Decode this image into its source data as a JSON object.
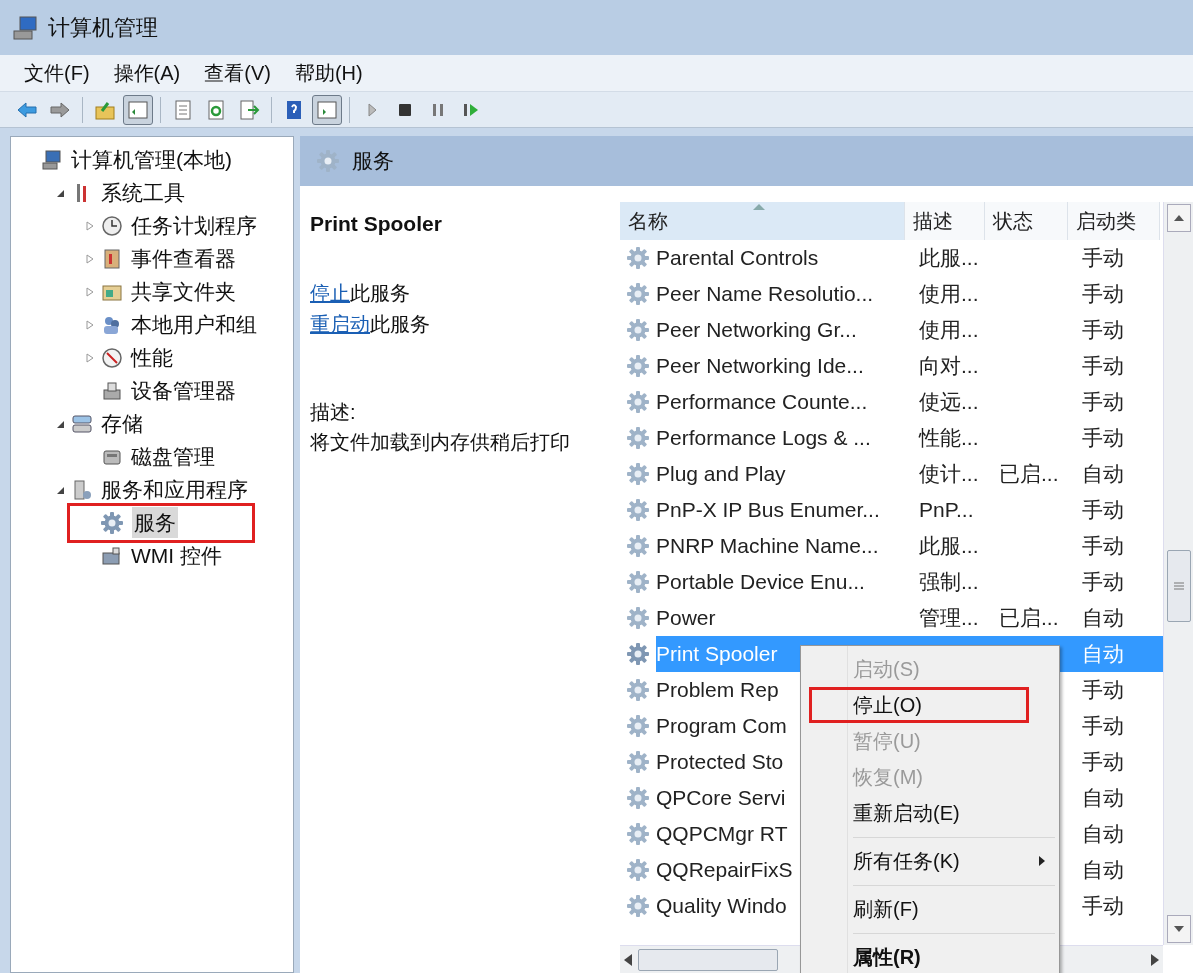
{
  "window": {
    "title": "计算机管理"
  },
  "menu": [
    "文件(F)",
    "操作(A)",
    "查看(V)",
    "帮助(H)"
  ],
  "toolbar": [
    {
      "kind": "back",
      "pressed": false
    },
    {
      "kind": "forward",
      "pressed": false
    },
    {
      "kind": "separator"
    },
    {
      "kind": "up",
      "pressed": false
    },
    {
      "kind": "tree-toggle",
      "pressed": true
    },
    {
      "kind": "separator"
    },
    {
      "kind": "properties",
      "pressed": false
    },
    {
      "kind": "refresh",
      "pressed": false
    },
    {
      "kind": "export",
      "pressed": false
    },
    {
      "kind": "separator"
    },
    {
      "kind": "help",
      "pressed": false
    },
    {
      "kind": "pane-toggle",
      "pressed": true
    },
    {
      "kind": "separator"
    },
    {
      "kind": "play",
      "pressed": false
    },
    {
      "kind": "stop",
      "pressed": false
    },
    {
      "kind": "pause",
      "pressed": false
    },
    {
      "kind": "resume",
      "pressed": false
    }
  ],
  "tree": [
    {
      "label": "计算机管理(本地)",
      "kind": "computer",
      "selected": false,
      "highlighted": false,
      "children": [
        {
          "label": "系统工具",
          "kind": "tools",
          "expanded": true,
          "selected": false,
          "highlighted": false,
          "children": [
            {
              "label": "任务计划程序",
              "kind": "clock",
              "expanded": false,
              "selected": false,
              "highlighted": false
            },
            {
              "label": "事件查看器",
              "kind": "event",
              "expanded": false,
              "selected": false,
              "highlighted": false
            },
            {
              "label": "共享文件夹",
              "kind": "share",
              "expanded": false,
              "selected": false,
              "highlighted": false
            },
            {
              "label": "本地用户和组",
              "kind": "users",
              "expanded": false,
              "selected": false,
              "highlighted": false
            },
            {
              "label": "性能",
              "kind": "perf",
              "expanded": false,
              "selected": false,
              "highlighted": false
            },
            {
              "label": "设备管理器",
              "kind": "device",
              "selected": false,
              "highlighted": false
            }
          ]
        },
        {
          "label": "存储",
          "kind": "storage",
          "expanded": true,
          "selected": false,
          "highlighted": false,
          "children": [
            {
              "label": "磁盘管理",
              "kind": "disk",
              "selected": false,
              "highlighted": false
            }
          ]
        },
        {
          "label": "服务和应用程序",
          "kind": "apps",
          "expanded": true,
          "selected": false,
          "highlighted": false,
          "children": [
            {
              "label": "服务",
              "kind": "gear",
              "selected": true,
              "highlighted": true
            },
            {
              "label": "WMI 控件",
              "kind": "wmi",
              "selected": false,
              "highlighted": false
            }
          ]
        }
      ]
    }
  ],
  "panel": {
    "title": "服务"
  },
  "extended": {
    "service_name": "Print Spooler",
    "actions": [
      {
        "link": "停止",
        "text": "此服务"
      },
      {
        "link": "重启动",
        "text": "此服务"
      }
    ],
    "description_label": "描述:",
    "description": "将文件加载到内存供稍后打印"
  },
  "table": {
    "columns": [
      {
        "label": "名称",
        "sorted": true
      },
      {
        "label": "描述",
        "sorted": false
      },
      {
        "label": "状态",
        "sorted": false
      },
      {
        "label": "启动类",
        "sorted": false
      }
    ],
    "rows": [
      {
        "name": "Parental Controls",
        "description": "此服...",
        "startup": "手动",
        "selected": false
      },
      {
        "name": "Peer Name Resolutio...",
        "description": "使用...",
        "startup": "手动",
        "selected": false
      },
      {
        "name": "Peer Networking Gr...",
        "description": "使用...",
        "startup": "手动",
        "selected": false
      },
      {
        "name": "Peer Networking Ide...",
        "description": "向对...",
        "startup": "手动",
        "selected": false
      },
      {
        "name": "Performance Counte...",
        "description": "使远...",
        "startup": "手动",
        "selected": false
      },
      {
        "name": "Performance Logs & ...",
        "description": "性能...",
        "startup": "手动",
        "selected": false
      },
      {
        "name": "Plug and Play",
        "description": "使计...",
        "status": "已启...",
        "startup": "自动",
        "selected": false
      },
      {
        "name": "PnP-X IP Bus Enumer...",
        "description": "PnP...",
        "startup": "手动",
        "selected": false
      },
      {
        "name": "PNRP Machine Name...",
        "description": "此服...",
        "startup": "手动",
        "selected": false
      },
      {
        "name": "Portable Device Enu...",
        "description": "强制...",
        "startup": "手动",
        "selected": false
      },
      {
        "name": "Power",
        "description": "管理...",
        "status": "已启...",
        "startup": "自动",
        "selected": false
      },
      {
        "name": "Print Spooler",
        "startup": "自动",
        "selected": true
      },
      {
        "name": "Problem Rep",
        "startup": "手动",
        "selected": false
      },
      {
        "name": "Program Com",
        "startup": "手动",
        "selected": false
      },
      {
        "name": "Protected Sto",
        "startup": "手动",
        "selected": false
      },
      {
        "name": "QPCore Servi",
        "startup": "自动",
        "selected": false
      },
      {
        "name": "QQPCMgr RT",
        "startup": "自动",
        "selected": false
      },
      {
        "name": "QQRepairFixS",
        "startup": "自动",
        "selected": false
      },
      {
        "name": "Quality Windo",
        "startup": "手动",
        "selected": false
      }
    ]
  },
  "context_menu": [
    {
      "kind": "item",
      "label": "启动(S)",
      "disabled": true,
      "default": false,
      "submenu": false,
      "highlighted": false
    },
    {
      "kind": "item",
      "label": "停止(O)",
      "disabled": false,
      "default": false,
      "submenu": false,
      "highlighted": true
    },
    {
      "kind": "item",
      "label": "暂停(U)",
      "disabled": true,
      "default": false,
      "submenu": false,
      "highlighted": false
    },
    {
      "kind": "item",
      "label": "恢复(M)",
      "disabled": true,
      "default": false,
      "submenu": false,
      "highlighted": false
    },
    {
      "kind": "item",
      "label": "重新启动(E)",
      "disabled": false,
      "default": false,
      "submenu": false,
      "highlighted": false
    },
    {
      "kind": "separator"
    },
    {
      "kind": "item",
      "label": "所有任务(K)",
      "disabled": false,
      "default": false,
      "submenu": true,
      "highlighted": false
    },
    {
      "kind": "separator"
    },
    {
      "kind": "item",
      "label": "刷新(F)",
      "disabled": false,
      "default": false,
      "submenu": false,
      "highlighted": false
    },
    {
      "kind": "separator"
    },
    {
      "kind": "item",
      "label": "属性(R)",
      "disabled": false,
      "default": true,
      "submenu": false,
      "highlighted": false
    }
  ]
}
